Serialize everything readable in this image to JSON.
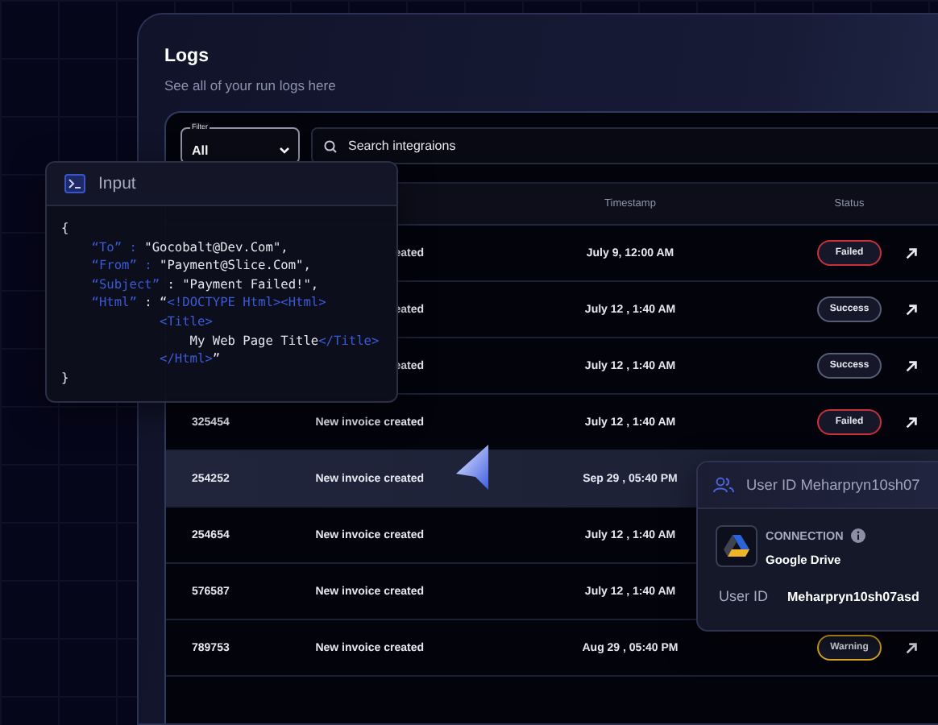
{
  "panel": {
    "title": "Logs",
    "subtitle": "See all of your run logs here"
  },
  "filter": {
    "label": "Filter",
    "value": "All"
  },
  "search": {
    "placeholder": "Search integraions"
  },
  "table": {
    "columns": [
      {
        "kind": "timestamp",
        "label": "Timestamp"
      },
      {
        "kind": "status",
        "label": "Status"
      }
    ],
    "rows": [
      {
        "event": "eated",
        "timestamp": "July 9, 12:00 AM",
        "status": {
          "label": "Failed",
          "kind": "failed"
        },
        "selected": false
      },
      {
        "event": "eated",
        "timestamp": "July 12 , 1:40 AM",
        "status": {
          "label": "Success",
          "kind": "success"
        },
        "selected": false
      },
      {
        "event": "eated",
        "timestamp": "July 12 , 1:40 AM",
        "status": {
          "label": "Success",
          "kind": "success"
        },
        "selected": false
      },
      {
        "id": "325454",
        "event": "New invoice created",
        "timestamp": "July 12 , 1:40 AM",
        "status": {
          "label": "Failed",
          "kind": "failed"
        },
        "selected": false
      },
      {
        "id": "254252",
        "event": "New invoice created",
        "timestamp": "Sep 29 , 05:40 PM",
        "selected": true
      },
      {
        "id": "254654",
        "event": "New invoice created",
        "timestamp": "July 12 , 1:40 AM",
        "selected": false
      },
      {
        "id": "576587",
        "event": "New invoice created",
        "timestamp": "July 12 , 1:40 AM",
        "selected": false
      },
      {
        "id": "789753",
        "event": "New invoice created",
        "timestamp": "Aug 29 , 05:40 PM",
        "status": {
          "label": "Warning",
          "kind": "warning"
        },
        "selected": false
      }
    ]
  },
  "input_card": {
    "title": "Input",
    "lines": [
      [
        {
          "text": "{",
          "kind": "plain"
        }
      ],
      [
        {
          "text": "    “To” : ",
          "kind": "key"
        },
        {
          "text": "\"Gocobalt@Dev.Com\",",
          "kind": "plain"
        }
      ],
      [
        {
          "text": "    “From” : ",
          "kind": "key"
        },
        {
          "text": "\"Payment@Slice.Com\",",
          "kind": "plain"
        }
      ],
      [
        {
          "text": "    “Subject”",
          "kind": "key"
        },
        {
          "text": " : \"Payment Failed!\",",
          "kind": "plain"
        }
      ],
      [
        {
          "text": "    “Html”",
          "kind": "key"
        },
        {
          "text": " : “",
          "kind": "plain"
        },
        {
          "text": "<!DOCTYPE Html><Html>",
          "kind": "key"
        }
      ],
      [
        {
          "text": "             <Title>",
          "kind": "key"
        }
      ],
      [
        {
          "text": "                 My Web Page Title",
          "kind": "plain"
        },
        {
          "text": "</Title>",
          "kind": "key"
        }
      ],
      [
        {
          "text": "             </Html>",
          "kind": "key"
        },
        {
          "text": "”",
          "kind": "plain"
        }
      ],
      [
        {
          "text": "}",
          "kind": "plain"
        }
      ]
    ]
  },
  "user_card": {
    "title": "User ID Meharpryn10sh07",
    "connection_label": "CONNECTION",
    "connection_name": "Google Drive",
    "field_label": "User ID",
    "field_value": "Meharpryn10sh07asd"
  }
}
